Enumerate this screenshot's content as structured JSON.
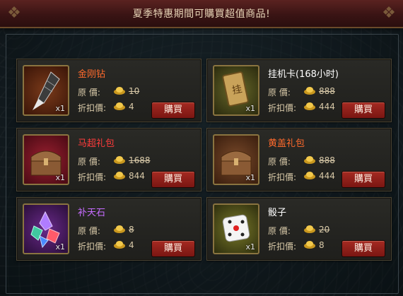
{
  "banner": {
    "text": "夏季特惠期間可購買超值商品!"
  },
  "labels": {
    "original": "原 價:",
    "discount": "折扣價:",
    "buy": "購買"
  },
  "items": [
    {
      "name": "金刚钻",
      "qty": "x1",
      "original": "10",
      "price": "4",
      "name_color": "#ff6a2c",
      "icon": "drill-bit-icon"
    },
    {
      "name": "挂机卡(168小时)",
      "qty": "x1",
      "original": "888",
      "price": "444",
      "name_color": "#ffffff",
      "icon": "card-icon"
    },
    {
      "name": "马超礼包",
      "qty": "x1",
      "original": "1688",
      "price": "844",
      "name_color": "#ff3b3b",
      "icon": "treasure-chest-icon"
    },
    {
      "name": "黄盖礼包",
      "qty": "x1",
      "original": "888",
      "price": "444",
      "name_color": "#ff6a2c",
      "icon": "treasure-chest-icon"
    },
    {
      "name": "补天石",
      "qty": "x1",
      "original": "8",
      "price": "4",
      "name_color": "#c66cff",
      "icon": "crystal-icon"
    },
    {
      "name": "骰子",
      "qty": "x1",
      "original": "20",
      "price": "8",
      "name_color": "#ffffff",
      "icon": "dice-icon"
    }
  ]
}
